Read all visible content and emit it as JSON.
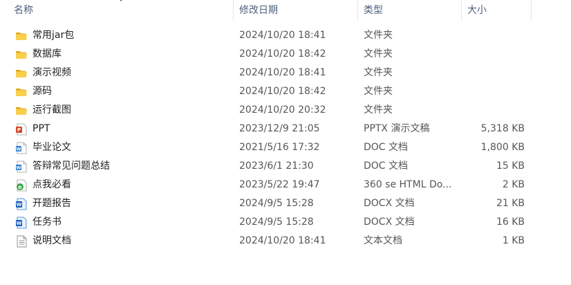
{
  "columns": {
    "name": "名称",
    "modified": "修改日期",
    "type": "类型",
    "size": "大小"
  },
  "files": [
    {
      "name": "常用jar包",
      "modified": "2024/10/20 18:41",
      "type": "文件夹",
      "size": "",
      "icon": "folder-icon"
    },
    {
      "name": "数据库",
      "modified": "2024/10/20 18:42",
      "type": "文件夹",
      "size": "",
      "icon": "folder-icon"
    },
    {
      "name": "演示视频",
      "modified": "2024/10/20 18:41",
      "type": "文件夹",
      "size": "",
      "icon": "folder-icon"
    },
    {
      "name": "源码",
      "modified": "2024/10/20 18:42",
      "type": "文件夹",
      "size": "",
      "icon": "folder-icon"
    },
    {
      "name": "运行截图",
      "modified": "2024/10/20 20:32",
      "type": "文件夹",
      "size": "",
      "icon": "folder-icon"
    },
    {
      "name": "PPT",
      "modified": "2023/12/9 21:05",
      "type": "PPTX 演示文稿",
      "size": "5,318 KB",
      "icon": "pptx-file-icon"
    },
    {
      "name": "毕业论文",
      "modified": "2021/5/16 17:32",
      "type": "DOC 文档",
      "size": "1,800 KB",
      "icon": "doc-file-icon"
    },
    {
      "name": "答辩常见问题总结",
      "modified": "2023/6/1 21:30",
      "type": "DOC 文档",
      "size": "15 KB",
      "icon": "doc-file-icon"
    },
    {
      "name": "点我必看",
      "modified": "2023/5/22 19:47",
      "type": "360 se HTML Do...",
      "size": "2 KB",
      "icon": "html-file-icon"
    },
    {
      "name": "开题报告",
      "modified": "2024/9/5 15:28",
      "type": "DOCX 文档",
      "size": "21 KB",
      "icon": "docx-file-icon"
    },
    {
      "name": "任务书",
      "modified": "2024/9/5 15:28",
      "type": "DOCX 文档",
      "size": "16 KB",
      "icon": "docx-file-icon"
    },
    {
      "name": "说明文档",
      "modified": "2024/10/20 18:41",
      "type": "文本文档",
      "size": "1 KB",
      "icon": "text-file-icon"
    }
  ]
}
